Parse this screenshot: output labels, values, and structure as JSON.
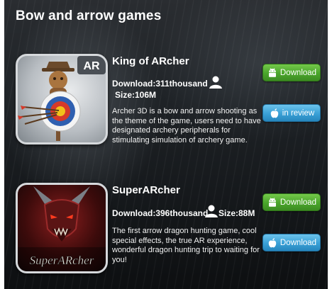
{
  "section_title": "Bow and arrow games",
  "games": [
    {
      "icon_badge": "AR",
      "name": "King of ARcher",
      "download_text": "Download:311thousand",
      "size_text": "Size:106M",
      "description": "Archer 3D is a bow and arrow shooting as the theme of the game, users need to have designated archery peripherals for stimulating simulation of archery game.",
      "android_button": "Download",
      "ios_button": "in review"
    },
    {
      "name": "SuperARcher",
      "download_text": "Download:396thousand",
      "size_text": "Size:88M",
      "description": "The first arrow dragon hunting game, cool special effects, the true AR experience, wonderful dragon hunting trip to waiting for you!",
      "android_button": "Download",
      "ios_button": "Download",
      "icon_logo_text": "SuperARcher"
    }
  ],
  "icons": {
    "user": "user-icon",
    "android": "android-icon",
    "apple": "apple-icon"
  },
  "colors": {
    "android_button": "#4aa52c",
    "ios_button": "#3aa0d6",
    "background": "#1e2226"
  }
}
